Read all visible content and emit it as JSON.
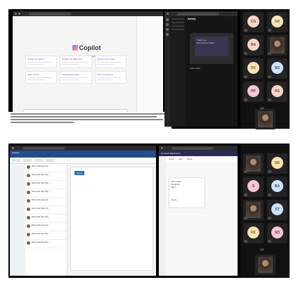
{
  "top": {
    "copilot": {
      "title": "Copilot",
      "subtitle": "Your everyday AI companion",
      "prompts": [
        "Create the perfect",
        "Explain the difference",
        "Review of the week",
        "Help me find",
        "Understand basics",
        "Minimize learning"
      ]
    },
    "teams": {
      "chat_title": "Ashley",
      "message_lines": [
        "Thank you",
        "Ravi Kumar Yadav"
      ],
      "add_reply": "Add a reply"
    },
    "participants": [
      {
        "initials": "CG",
        "color": "#f6d6c8",
        "text_color": "#8a3c22"
      },
      {
        "initials": "SR",
        "color": "#f7e3b5",
        "text_color": "#8a6420"
      },
      {
        "initials": "BA",
        "color": "#f6d6c8",
        "text_color": "#8a3c22"
      },
      {
        "initials": "",
        "camera": true
      },
      {
        "initials": "RK",
        "color": "#f7e3b5",
        "text_color": "#8a6420"
      },
      {
        "initials": "BS",
        "color": "#cfe3f7",
        "text_color": "#225a8a"
      },
      {
        "initials": "PP",
        "color": "#f4c6d9",
        "text_color": "#8a2252"
      },
      {
        "initials": "RS",
        "color": "#f6d6c8",
        "text_color": "#8a3c22"
      },
      {
        "initials": "",
        "camera": true
      }
    ],
    "pager": "1/2"
  },
  "bottom": {
    "outlook": {
      "title": "Outlook",
      "send_label": "Send",
      "messages": [
        "Microsoft Security",
        "Microsoft Security",
        "Microsoft Security",
        "Microsoft Security",
        "Microsoft Security",
        "Microsoft Security",
        "Microsoft Security",
        "Microsoft Security",
        "Microsoft Security",
        "Microsoft Security"
      ]
    },
    "teams": {
      "title": "Common Electronics",
      "tabs": [
        "Posts",
        "Files",
        "Notes"
      ],
      "post_lines": [
        "Test email",
        "Regards",
        "Ravi"
      ],
      "reply_label": "Reply"
    },
    "participants": [
      {
        "initials": "",
        "camera": true
      },
      {
        "initials": "SR",
        "color": "#f7e3b5",
        "text_color": "#8a6420"
      },
      {
        "initials": "S",
        "color": "#f4c6d9",
        "text_color": "#8a2252"
      },
      {
        "initials": "BA",
        "color": "#cfe3f7",
        "text_color": "#225a8a"
      },
      {
        "initials": "",
        "camera": true
      },
      {
        "initials": "ST",
        "color": "#cfe3f7",
        "text_color": "#225a8a"
      },
      {
        "initials": "RK",
        "color": "#f7e3b5",
        "text_color": "#8a6420"
      },
      {
        "initials": "SO",
        "color": "#f4c6d9",
        "text_color": "#8a2252"
      },
      {
        "initials": "",
        "camera": true
      }
    ],
    "pager": "1/2"
  }
}
